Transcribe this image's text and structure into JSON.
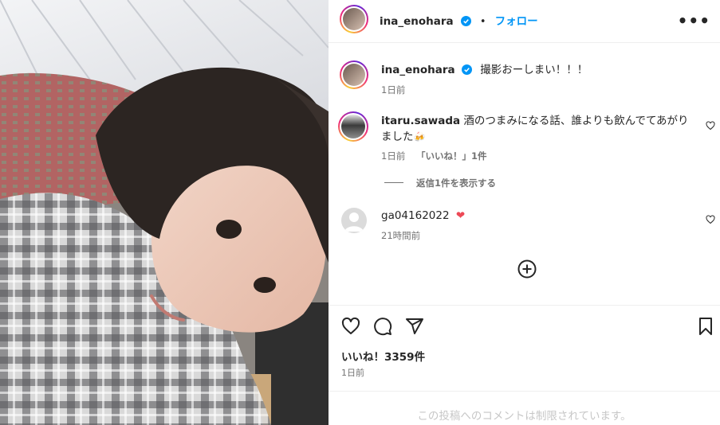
{
  "post": {
    "username": "ina_enohara",
    "follow_label": "フォロー",
    "more_label": "•••",
    "dot": "•"
  },
  "caption": {
    "username": "ina_enohara",
    "text": "撮影おーしまい！！！",
    "time": "1日前"
  },
  "comments": [
    {
      "username": "itaru.sawada",
      "text": "酒のつまみになる話、誰よりも飲んでてあがりました",
      "emoji": "🍻",
      "time": "1日前",
      "likes": "「いいね！」1件",
      "replies": "返信1件を表示する"
    },
    {
      "username": "ga04162022",
      "emoji": "❤",
      "time": "21時間前"
    }
  ],
  "footer": {
    "likes": "いいね！3359件",
    "posted": "1日前",
    "restricted": "この投稿へのコメントは制限されています。"
  },
  "colors": {
    "accent": "#0095f6",
    "heart": "#ed4956",
    "text": "#262626",
    "muted": "#737373"
  }
}
